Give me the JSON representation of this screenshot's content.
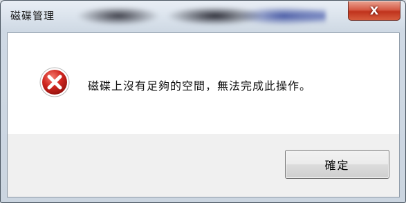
{
  "window": {
    "title": "磁碟管理",
    "close_label": "X"
  },
  "dialog": {
    "icon": "error-icon",
    "message": "磁碟上沒有足夠的空間，無法完成此操作。",
    "ok_label": "確定"
  },
  "colors": {
    "error_red": "#c8201b",
    "close_button": "#c8412a"
  }
}
